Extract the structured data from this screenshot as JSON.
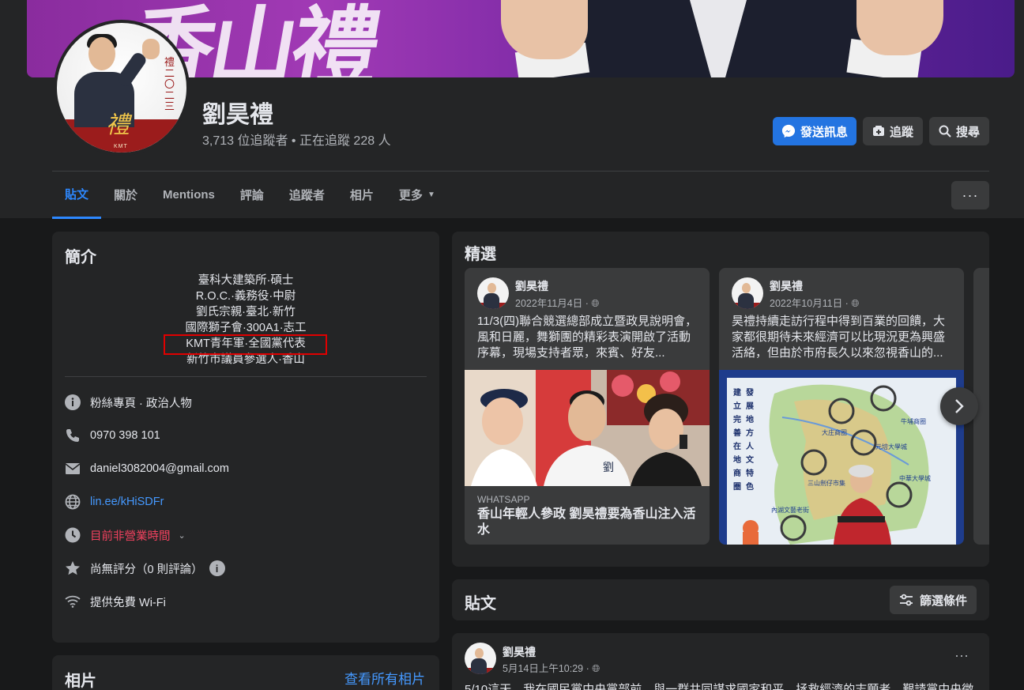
{
  "cover": {
    "text": "香山禮"
  },
  "profile": {
    "name": "劉昊禮",
    "stats": "3,713 位追蹤者 • 正在追蹤 228 人",
    "avatar_vertical_text": "禮二〇二三",
    "avatar_brand": "KMT"
  },
  "actions": {
    "message": "發送訊息",
    "follow": "追蹤",
    "search": "搜尋"
  },
  "tabs": [
    {
      "label": "貼文"
    },
    {
      "label": "關於"
    },
    {
      "label": "Mentions"
    },
    {
      "label": "評論"
    },
    {
      "label": "追蹤者"
    },
    {
      "label": "相片"
    },
    {
      "label": "更多"
    }
  ],
  "more_menu": "···",
  "intro": {
    "title": "簡介",
    "bio": [
      "臺科大建築所·碩士",
      "R.O.C.·義務役·中尉",
      "劉氏宗親·臺北·新竹",
      "國際獅子會·300A1·志工",
      "KMT青年軍·全國黨代表",
      "新竹市議員參選人·香山"
    ],
    "category": "粉絲專頁 · 政治人物",
    "phone": "0970 398 101",
    "email": "daniel3082004@gmail.com",
    "website": "lin.ee/kHiSDFr",
    "hours": "目前非營業時間",
    "rating": "尚無評分（0 則評論）",
    "wifi": "提供免費 Wi-Fi"
  },
  "photos": {
    "title": "相片",
    "see_all": "查看所有相片"
  },
  "featured": {
    "title": "精選",
    "cards": [
      {
        "author": "劉昊禮",
        "date": "2022年11月4日 ·",
        "text": "11/3(四)聯合競選總部成立暨政見說明會，風和日麗，舞獅團的精彩表演開啟了活動序幕，現場支持者眾，來賓、好友...",
        "source": "WHATSAPP",
        "headline": "香山年輕人參政 劉昊禮要為香山注入活水"
      },
      {
        "author": "劉昊禮",
        "date": "2022年10月11日 ·",
        "text": "昊禮持續走訪行程中得到百業的回饋，大家都很期待未來經濟可以比現況更為興盛活絡，但由於市府長久以來忽視香山的...",
        "map_vertical_text": "建立完善在地商圈 發展地方人文特色",
        "map_labels": [
          "牛埔商圈",
          "大庄商圈",
          "元培大學城",
          "中華大學城",
          "三山劍仔市集",
          "內湖文藝老街"
        ]
      }
    ]
  },
  "posts": {
    "title": "貼文",
    "filter": "篩選條件",
    "items": [
      {
        "author": "劉昊禮",
        "date": "5月14日上午10:29 ·",
        "text": "5/10這天，我在國民黨中央黨部前，與一群共同謀求國家和平、拯救經濟的志願者，艱請黨中央徵"
      }
    ]
  }
}
